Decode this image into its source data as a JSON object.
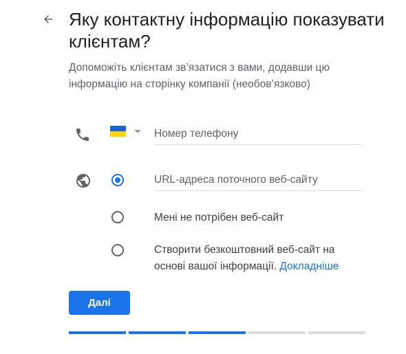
{
  "header": {
    "back_icon": "arrow-left-icon",
    "title": "Яку контактну інформацію показувати клієнтам?",
    "subtitle": "Допоможіть клієнтам зв’язатися з вами, додавши цю інформацію на сторінку компанії (необов’язково)"
  },
  "phone": {
    "icon": "phone-icon",
    "country_flag": "ukraine-flag",
    "placeholder": "Номер телефону",
    "value": ""
  },
  "website": {
    "icon": "globe-icon",
    "options": [
      {
        "label": "URL-адреса поточного веб-сайту",
        "selected": true,
        "is_input": true
      },
      {
        "label": "Мені не потрібен веб-сайт",
        "selected": false
      },
      {
        "label": "Створити безкоштовний веб-сайт на основі вашої інформації.",
        "link": "Докладніше",
        "selected": false
      }
    ]
  },
  "actions": {
    "next_label": "Далі"
  },
  "progress": {
    "total_steps": 5,
    "completed_steps": 3
  },
  "colors": {
    "accent": "#1a73e8",
    "text": "#202124",
    "secondary": "#5f6368"
  }
}
